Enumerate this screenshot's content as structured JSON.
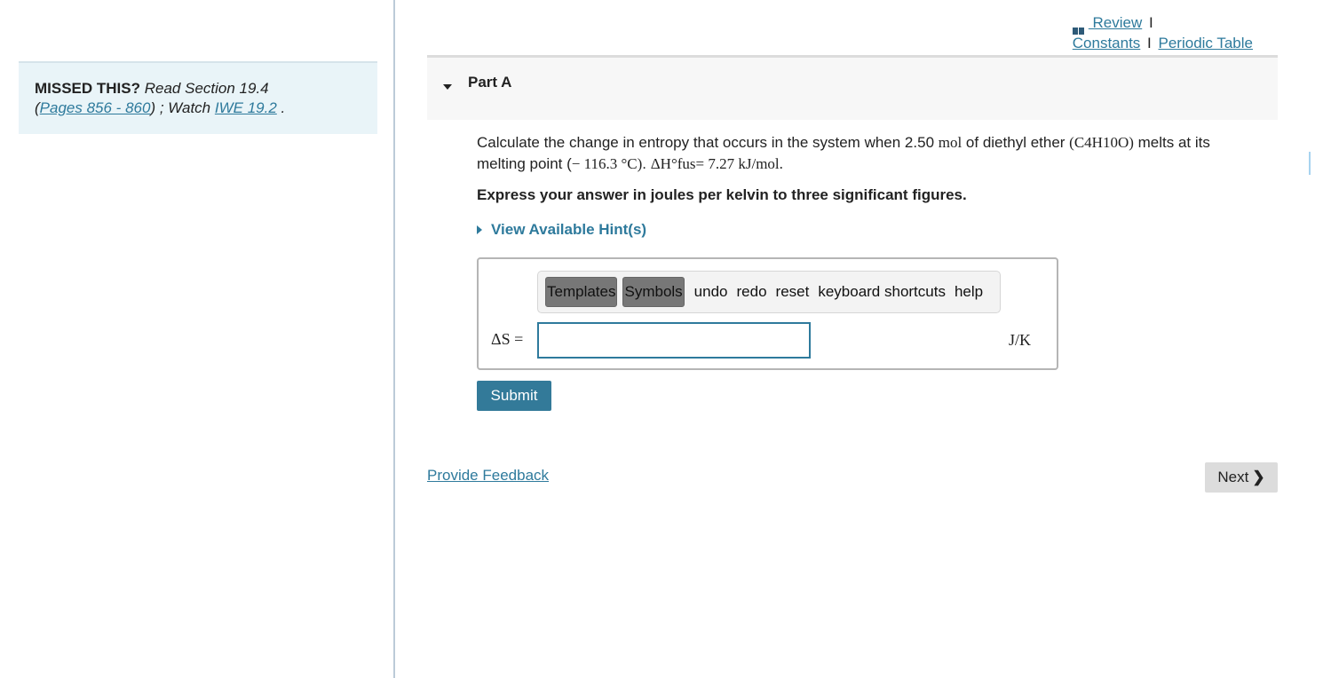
{
  "sidebar": {
    "missed_label": "MISSED THIS?",
    "read_text": " Read Section 19.4",
    "open_paren": "(",
    "pages_link": "Pages 856 - 860",
    "watch_text": ") ; Watch ",
    "iwe_link": "IWE 19.2",
    "end_text": " ."
  },
  "toplinks": {
    "review": " Review",
    "constants": "Constants",
    "periodic_table": "Periodic Table",
    "separator": "I"
  },
  "part": {
    "title": "Part A"
  },
  "question": {
    "line1_a": "Calculate the change in entropy that occurs in the system when 2.50 ",
    "line1_mol": "mol",
    "line1_b": " of diethyl ether ",
    "formula": "(C4H10O)",
    "line1_c": " melts at its",
    "line2_a": "melting point (",
    "line2_temp": "− 116.3 °C)",
    "line2_b": ". ",
    "line2_dh": "ΔH°fus= 7.27 kJ/mol.",
    "instruction": "Express your answer in joules per kelvin to three significant figures.",
    "hint": "View Available Hint(s)"
  },
  "toolbar": {
    "templates": "Templates",
    "symbols": "Symbols",
    "undo": "undo",
    "redo": "redo",
    "reset": "reset",
    "shortcuts": "keyboard shortcuts",
    "help": "help"
  },
  "answer": {
    "label": "ΔS =",
    "value": "",
    "unit": "J/K"
  },
  "buttons": {
    "submit": "Submit",
    "next": "Next",
    "feedback": "Provide Feedback"
  }
}
